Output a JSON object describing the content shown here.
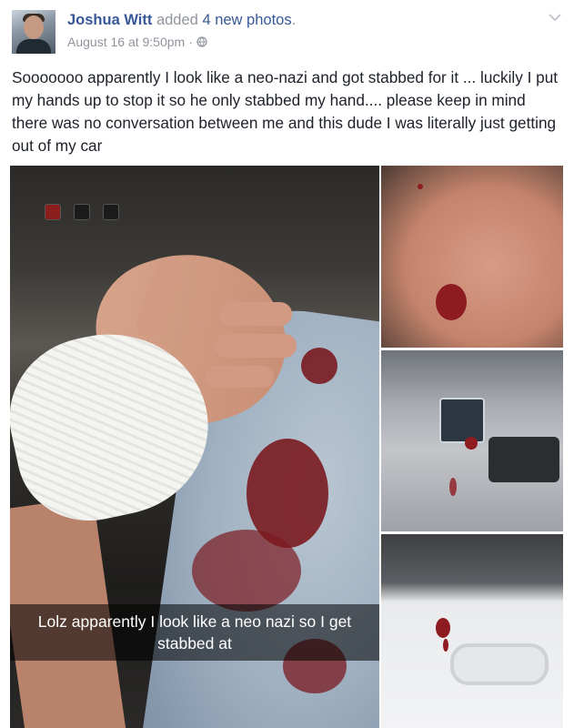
{
  "post": {
    "author": "Joshua Witt",
    "action": "added",
    "count_label": "4 new photos",
    "action_suffix": ".",
    "timestamp": "August 16 at 9:50pm",
    "separator": "·",
    "audience_icon": "globe-icon",
    "menu_icon": "chevron-down-icon",
    "text": "Sooooooo apparently I look like a neo-nazi and got stabbed for it ... luckily I put my hands up to stop it so he only stabbed my hand.... please keep in mind there was no conversation between me and this dude I was literally just getting out of my car"
  },
  "photos": {
    "main_caption": "Lolz apparently I look like a neo nazi so I get stabbed at"
  },
  "colors": {
    "link": "#365899",
    "meta": "#90949c",
    "text": "#1d2129"
  }
}
